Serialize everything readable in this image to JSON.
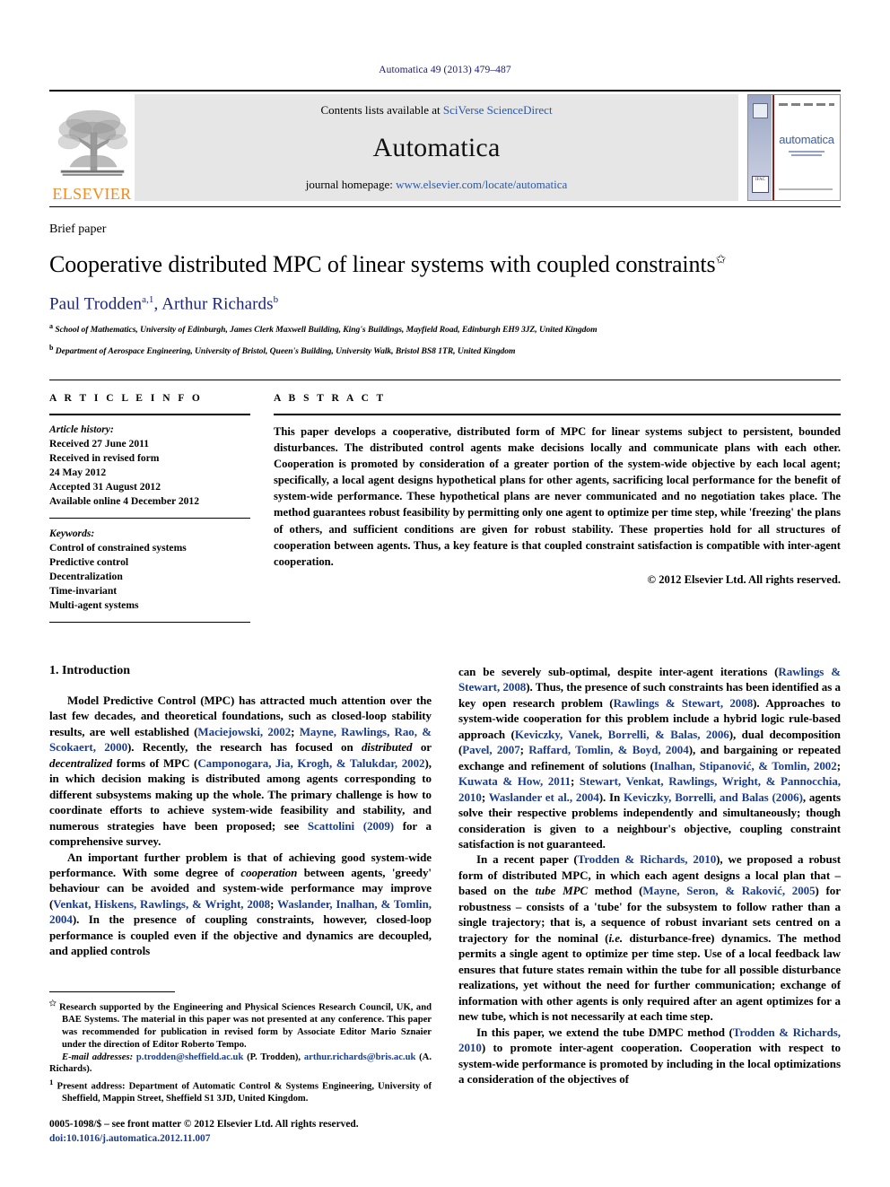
{
  "running_head": "Automatica 49 (2013) 479–487",
  "masthead": {
    "publisher_wordmark": "ELSEVIER",
    "contents_prefix": "Contents lists available at ",
    "contents_link": "SciVerse ScienceDirect",
    "journal_name": "Automatica",
    "homepage_prefix": "journal homepage: ",
    "homepage_link": "www.elsevier.com/locate/automatica",
    "cover_title": "automatica"
  },
  "article": {
    "type_label": "Brief paper",
    "title": "Cooperative distributed MPC of linear systems with coupled constraints",
    "title_footnote_mark": "✩",
    "authors_plain": "Paul Trodden a,1, Arthur Richards b",
    "author_1_name": "Paul Trodden",
    "author_1_marks": "a,1",
    "author_separator": ", ",
    "author_2_name": "Arthur Richards",
    "author_2_marks": "b",
    "affiliation_a_mark": "a",
    "affiliation_a": "School of Mathematics, University of Edinburgh, James Clerk Maxwell Building, King's Buildings, Mayfield Road, Edinburgh EH9 3JZ, United Kingdom",
    "affiliation_b_mark": "b",
    "affiliation_b": "Department of Aerospace Engineering, University of Bristol, Queen's Building, University Walk, Bristol BS8 1TR, United Kingdom"
  },
  "info": {
    "heading": "A R T I C L E   I N F O",
    "history_label": "Article history:",
    "history": [
      "Received 27 June 2011",
      "Received in revised form",
      "24 May 2012",
      "Accepted 31 August 2012",
      "Available online 4 December 2012"
    ],
    "keywords_label": "Keywords:",
    "keywords": [
      "Control of constrained systems",
      "Predictive control",
      "Decentralization",
      "Time-invariant",
      "Multi-agent systems"
    ]
  },
  "abstract": {
    "heading": "A B S T R A C T",
    "text": "This paper develops a cooperative, distributed form of MPC for linear systems subject to persistent, bounded disturbances. The distributed control agents make decisions locally and communicate plans with each other. Cooperation is promoted by consideration of a greater portion of the system-wide objective by each local agent; specifically, a local agent designs hypothetical plans for other agents, sacrificing local performance for the benefit of system-wide performance. These hypothetical plans are never communicated and no negotiation takes place. The method guarantees robust feasibility by permitting only one agent to optimize per time step, while 'freezing' the plans of others, and sufficient conditions are given for robust stability. These properties hold for all structures of cooperation between agents. Thus, a key feature is that coupled constraint satisfaction is compatible with inter-agent cooperation.",
    "copyright": "© 2012 Elsevier Ltd. All rights reserved."
  },
  "body": {
    "section_number_title": "1. Introduction",
    "left_p1_a": "Model Predictive Control (MPC) has attracted much attention over the last few decades, and theoretical foundations, such as closed-loop stability results, are well established (",
    "left_p1_cite1": "Maciejowski, 2002",
    "left_p1_b": "; ",
    "left_p1_cite2": "Mayne, Rawlings, Rao, & Scokaert, 2000",
    "left_p1_c": "). Recently, the research has focused on ",
    "left_p1_ital1": "distributed",
    "left_p1_d": " or ",
    "left_p1_ital2": "decentralized",
    "left_p1_e": " forms of MPC (",
    "left_p1_cite3": "Camponogara, Jia, Krogh, & Talukdar, 2002",
    "left_p1_f": "), in which decision making is distributed among agents corresponding to different subsystems making up the whole. The primary challenge is how to coordinate efforts to achieve system-wide feasibility and stability, and numerous strategies have been proposed; see ",
    "left_p1_cite4": "Scattolini (2009)",
    "left_p1_g": " for a comprehensive survey.",
    "left_p2_a": "An important further problem is that of achieving good system-wide performance. With some degree of ",
    "left_p2_ital1": "cooperation",
    "left_p2_b": " between agents, 'greedy' behaviour can be avoided and system-wide performance may improve (",
    "left_p2_cite1": "Venkat, Hiskens, Rawlings, & Wright, 2008",
    "left_p2_c": "; ",
    "left_p2_cite2": "Waslander, Inalhan, & Tomlin, 2004",
    "left_p2_d": "). In the presence of coupling constraints, however, closed-loop performance is coupled even if the objective and dynamics are decoupled, and applied controls",
    "right_p1_a": "can be severely sub-optimal, despite inter-agent iterations (",
    "right_p1_cite1": "Rawlings & Stewart, 2008",
    "right_p1_b": "). Thus, the presence of such constraints has been identified as a key open research problem (",
    "right_p1_cite2": "Rawlings & Stewart, 2008",
    "right_p1_c": "). Approaches to system-wide cooperation for this problem include a hybrid logic rule-based approach (",
    "right_p1_cite3": "Keviczky, Vanek, Borrelli, & Balas, 2006",
    "right_p1_d": "), dual decomposition (",
    "right_p1_cite4": "Pavel, 2007",
    "right_p1_e": "; ",
    "right_p1_cite5": "Raffard, Tomlin, & Boyd, 2004",
    "right_p1_f": "), and bargaining or repeated exchange and refinement of solutions (",
    "right_p1_cite6": "Inalhan, Stipanović, & Tomlin, 2002",
    "right_p1_g": "; ",
    "right_p1_cite7": "Kuwata & How, 2011",
    "right_p1_h": "; ",
    "right_p1_cite8": "Stewart, Venkat, Rawlings, Wright, & Pannocchia, 2010",
    "right_p1_i": "; ",
    "right_p1_cite9": "Waslander et al., 2004",
    "right_p1_j": "). In ",
    "right_p1_cite10": "Keviczky, Borrelli, and Balas (2006)",
    "right_p1_k": ", agents solve their respective problems independently and simultaneously; though consideration is given to a neighbour's objective, coupling constraint satisfaction is not guaranteed.",
    "right_p2_a": "In a recent paper (",
    "right_p2_cite1": "Trodden & Richards, 2010",
    "right_p2_b": "), we proposed a robust form of distributed MPC, in which each agent designs a local plan that – based on the ",
    "right_p2_ital1": "tube MPC",
    "right_p2_c": " method (",
    "right_p2_cite2": "Mayne, Seron, & Raković, 2005",
    "right_p2_d": ") for robustness – consists of a 'tube' for the subsystem to follow rather than a single trajectory; that is, a sequence of robust invariant sets centred on a trajectory for the nominal (",
    "right_p2_ital2": "i.e.",
    "right_p2_e": " disturbance-free) dynamics. The method permits a single agent to optimize per time step. Use of a local feedback law ensures that future states remain within the tube for all possible disturbance realizations, yet without the need for further communication; exchange of information with other agents is only required after an agent optimizes for a new tube, which is not necessarily at each time step.",
    "right_p3_a": "In this paper, we extend the tube DMPC method (",
    "right_p3_cite1": "Trodden & Richards, 2010",
    "right_p3_b": ") to promote inter-agent cooperation. Cooperation with respect to system-wide performance is promoted by including in the local optimizations a consideration of the objectives of"
  },
  "footnotes": {
    "star_mark": "✩",
    "star_text": "Research supported by the Engineering and Physical Sciences Research Council, UK, and BAE Systems. The material in this paper was not presented at any conference. This paper was recommended for publication in revised form by Associate Editor Mario Sznaier under the direction of Editor Roberto Tempo.",
    "email_label": "E-mail addresses:",
    "email_1": "p.trodden@sheffield.ac.uk",
    "email_1_owner": " (P. Trodden),",
    "email_2": "arthur.richards@bris.ac.uk",
    "email_2_owner": " (A. Richards).",
    "present_mark": "1",
    "present_text": "Present address: Department of Automatic Control & Systems Engineering, University of Sheffield, Mappin Street, Sheffield S1 3JD, United Kingdom.",
    "issn_line": "0005-1098/$ – see front matter © 2012 Elsevier Ltd. All rights reserved.",
    "doi_prefix": "doi:",
    "doi_value": "10.1016/j.automatica.2012.11.007"
  },
  "colors": {
    "link_blue": "#2b58a8",
    "cite_blue": "#1b3c8c",
    "author_blue": "#1a237e",
    "elsevier_orange": "#f08c1e",
    "cover_red": "#8b1a1a",
    "panel_gray": "#e6e6e6"
  }
}
